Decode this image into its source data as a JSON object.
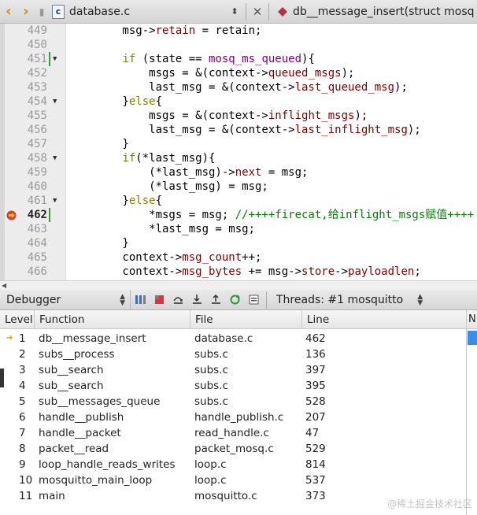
{
  "editor_toolbar": {
    "file_icon_label": "c",
    "file_name": "database.c",
    "symbol": "db__message_insert(struct mosq"
  },
  "code_lines": [
    {
      "num": "449",
      "segments": [
        [
          "",
          "        msg->"
        ],
        [
          "mb",
          "retain"
        ],
        [
          "",
          " = retain;"
        ]
      ]
    },
    {
      "num": "450",
      "segments": [
        [
          "",
          ""
        ]
      ]
    },
    {
      "num": "451",
      "fold": true,
      "mark": true,
      "segments": [
        [
          "",
          "        "
        ],
        [
          "kw",
          "if"
        ],
        [
          "",
          " (state == "
        ],
        [
          "en",
          "mosq_ms_queued"
        ],
        [
          "",
          "){"
        ]
      ]
    },
    {
      "num": "452",
      "segments": [
        [
          "",
          "            msgs = &(context->"
        ],
        [
          "mb",
          "queued_msgs"
        ],
        [
          "",
          ");"
        ]
      ]
    },
    {
      "num": "453",
      "segments": [
        [
          "",
          "            last_msg = &(context->"
        ],
        [
          "mb",
          "last_queued_msg"
        ],
        [
          "",
          ");"
        ]
      ]
    },
    {
      "num": "454",
      "fold": true,
      "segments": [
        [
          "",
          "        }"
        ],
        [
          "kw",
          "else"
        ],
        [
          "",
          "{"
        ]
      ]
    },
    {
      "num": "455",
      "segments": [
        [
          "",
          "            msgs = &(context->"
        ],
        [
          "mb",
          "inflight_msgs"
        ],
        [
          "",
          ");"
        ]
      ]
    },
    {
      "num": "456",
      "segments": [
        [
          "",
          "            last_msg = &(context->"
        ],
        [
          "mb",
          "last_inflight_msg"
        ],
        [
          "",
          ");"
        ]
      ]
    },
    {
      "num": "457",
      "segments": [
        [
          "",
          "        }"
        ]
      ]
    },
    {
      "num": "458",
      "fold": true,
      "segments": [
        [
          "",
          "        "
        ],
        [
          "kw",
          "if"
        ],
        [
          "",
          "(*last_msg){"
        ]
      ]
    },
    {
      "num": "459",
      "segments": [
        [
          "",
          "            (*last_msg)->"
        ],
        [
          "mb",
          "next"
        ],
        [
          "",
          " = msg;"
        ]
      ]
    },
    {
      "num": "460",
      "segments": [
        [
          "",
          "            (*last_msg) = msg;"
        ]
      ]
    },
    {
      "num": "461",
      "fold": true,
      "segments": [
        [
          "",
          "        }"
        ],
        [
          "kw",
          "else"
        ],
        [
          "",
          "{"
        ]
      ]
    },
    {
      "num": "462",
      "current": true,
      "mark": true,
      "segments": [
        [
          "",
          "            *msgs = msg; "
        ],
        [
          "cm",
          "//++++firecat,给inflight_msgs赋值++++"
        ]
      ]
    },
    {
      "num": "463",
      "segments": [
        [
          "",
          "            *last_msg = msg;"
        ]
      ]
    },
    {
      "num": "464",
      "segments": [
        [
          "",
          "        }"
        ]
      ]
    },
    {
      "num": "465",
      "segments": [
        [
          "",
          "        context->"
        ],
        [
          "mb",
          "msg_count"
        ],
        [
          "",
          "++;"
        ]
      ]
    },
    {
      "num": "466",
      "segments": [
        [
          "",
          "        context->"
        ],
        [
          "mb",
          "msg_bytes"
        ],
        [
          "",
          " += msg->"
        ],
        [
          "mb",
          "store"
        ],
        [
          "",
          "->"
        ],
        [
          "mb",
          "payloadlen"
        ],
        [
          "",
          ";"
        ]
      ]
    }
  ],
  "debugger": {
    "panel_title": "Debugger",
    "threads_label": "Threads:",
    "threads_value": "#1 mosquitto",
    "columns": [
      "Level",
      "Function",
      "File",
      "Line"
    ],
    "side_column": "N",
    "frames": [
      {
        "level": "1",
        "function": "db__message_insert",
        "file": "database.c",
        "line": "462"
      },
      {
        "level": "2",
        "function": "subs__process",
        "file": "subs.c",
        "line": "136"
      },
      {
        "level": "3",
        "function": "sub__search",
        "file": "subs.c",
        "line": "397"
      },
      {
        "level": "4",
        "function": "sub__search",
        "file": "subs.c",
        "line": "395"
      },
      {
        "level": "5",
        "function": "sub__messages_queue",
        "file": "subs.c",
        "line": "528"
      },
      {
        "level": "6",
        "function": "handle__publish",
        "file": "handle_publish.c",
        "line": "207"
      },
      {
        "level": "7",
        "function": "handle__packet",
        "file": "read_handle.c",
        "line": "47"
      },
      {
        "level": "8",
        "function": "packet__read",
        "file": "packet_mosq.c",
        "line": "529"
      },
      {
        "level": "9",
        "function": "loop_handle_reads_writes",
        "file": "loop.c",
        "line": "814"
      },
      {
        "level": "10",
        "function": "mosquitto_main_loop",
        "file": "loop.c",
        "line": "537"
      },
      {
        "level": "11",
        "function": "main",
        "file": "mosquitto.c",
        "line": "373"
      }
    ]
  },
  "watermark": "@稀土掘金技术社区",
  "colors": {
    "keyword": "#808000",
    "member": "#800000",
    "enum": "#800080",
    "comment": "#008000",
    "accent": "#e09a00",
    "selection": "#3a8ee6"
  }
}
